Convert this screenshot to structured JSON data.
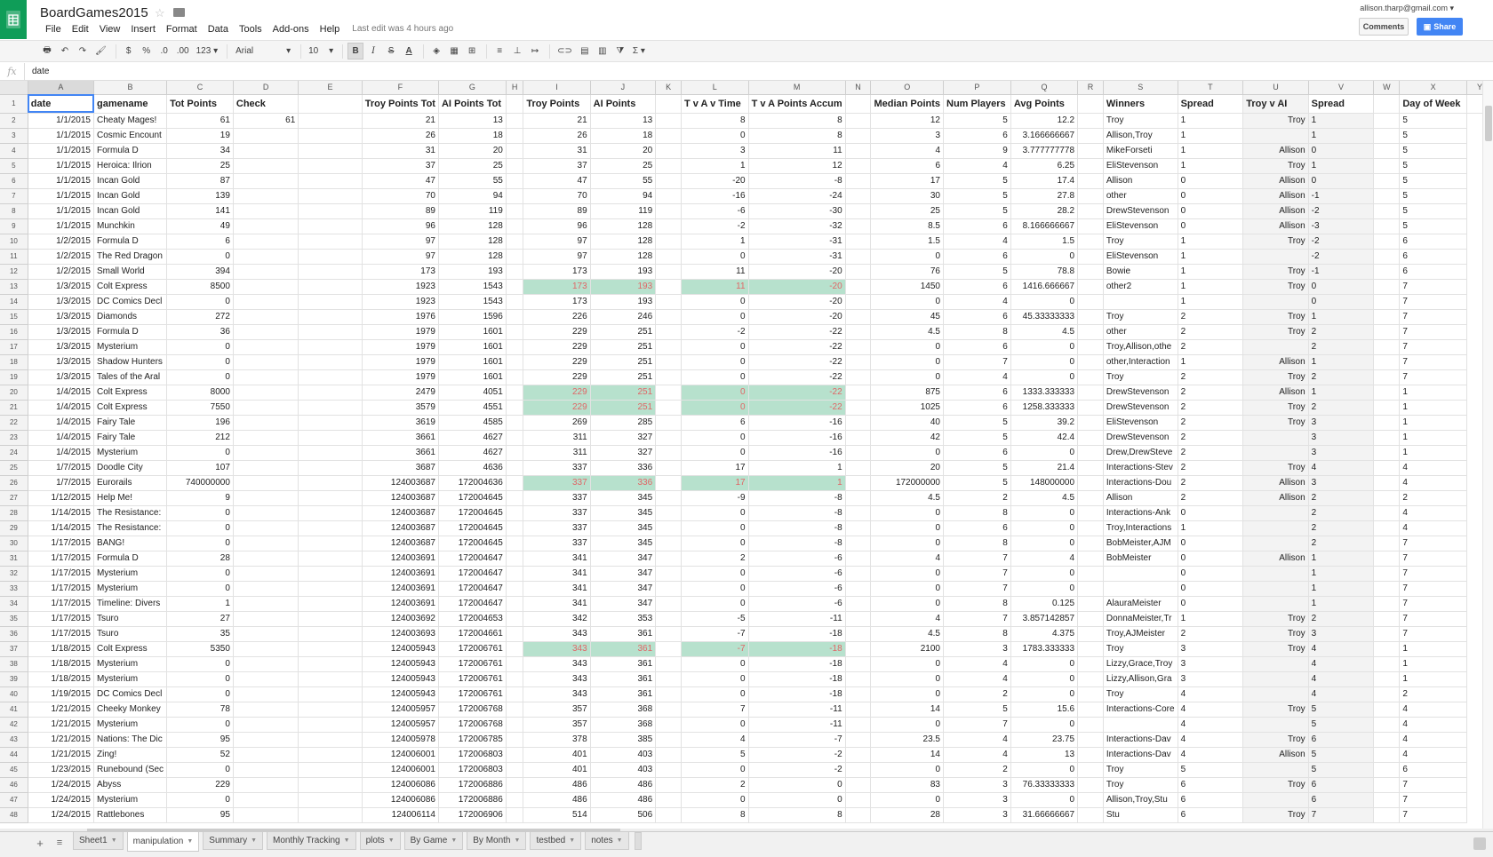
{
  "app": {
    "title": "BoardGames2015",
    "user_email": "allison.tharp@gmail.com",
    "comments_label": "Comments",
    "share_label": "Share",
    "last_edit": "Last edit was 4 hours ago",
    "menu": [
      "File",
      "Edit",
      "View",
      "Insert",
      "Format",
      "Data",
      "Tools",
      "Add-ons",
      "Help"
    ]
  },
  "toolbar": {
    "currency": "$",
    "percent": "%",
    "dec_less": ".0",
    "dec_more": ".00",
    "more_formats": "123",
    "font": "Arial",
    "size": "10",
    "bold": "B",
    "italic": "I",
    "strike": "S",
    "textcolor": "A",
    "sum": "Σ"
  },
  "formula": {
    "fx": "fx",
    "value": "date"
  },
  "columns": [
    "A",
    "B",
    "C",
    "D",
    "E",
    "F",
    "G",
    "H",
    "I",
    "J",
    "K",
    "L",
    "M",
    "N",
    "O",
    "P",
    "Q",
    "R",
    "S",
    "T",
    "U",
    "V",
    "W",
    "X",
    "Y"
  ],
  "header_row": [
    "date",
    "gamename",
    "Tot Points",
    "Check",
    "",
    "Troy Points Tot",
    "AI Points Tot",
    "",
    "Troy Points",
    "AI Points",
    "",
    "T v A v Time",
    "T v A Points Accum",
    "",
    "Median Points",
    "Num Players",
    "Avg Points",
    "",
    "Winners",
    "Spread",
    "Troy v AI",
    "Spread",
    "",
    "Day of Week",
    ""
  ],
  "rows": [
    [
      "2",
      "1/1/2015",
      "Cheaty Mages!",
      "61",
      "61",
      "",
      "21",
      "13",
      "",
      "21",
      "13",
      "",
      "8",
      "8",
      "",
      "12",
      "5",
      "12.2",
      "",
      "Troy",
      "1",
      "Troy",
      "1",
      "",
      "5"
    ],
    [
      "3",
      "1/1/2015",
      "Cosmic Encount",
      "19",
      "",
      "",
      "26",
      "18",
      "",
      "26",
      "18",
      "",
      "0",
      "8",
      "",
      "3",
      "6",
      "3.166666667",
      "",
      "Allison,Troy",
      "1",
      "",
      "1",
      "",
      "5"
    ],
    [
      "4",
      "1/1/2015",
      "Formula D",
      "34",
      "",
      "",
      "31",
      "20",
      "",
      "31",
      "20",
      "",
      "3",
      "11",
      "",
      "4",
      "9",
      "3.777777778",
      "",
      "MikeForseti",
      "1",
      "Allison",
      "0",
      "",
      "5"
    ],
    [
      "5",
      "1/1/2015",
      "Heroica: Ilrion",
      "25",
      "",
      "",
      "37",
      "25",
      "",
      "37",
      "25",
      "",
      "1",
      "12",
      "",
      "6",
      "4",
      "6.25",
      "",
      "EliStevenson",
      "1",
      "Troy",
      "1",
      "",
      "5"
    ],
    [
      "6",
      "1/1/2015",
      "Incan Gold",
      "87",
      "",
      "",
      "47",
      "55",
      "",
      "47",
      "55",
      "",
      "-20",
      "-8",
      "",
      "17",
      "5",
      "17.4",
      "",
      "Allison",
      "0",
      "Allison",
      "0",
      "",
      "5"
    ],
    [
      "7",
      "1/1/2015",
      "Incan Gold",
      "139",
      "",
      "",
      "70",
      "94",
      "",
      "70",
      "94",
      "",
      "-16",
      "-24",
      "",
      "30",
      "5",
      "27.8",
      "",
      "other",
      "0",
      "Allison",
      "-1",
      "",
      "5"
    ],
    [
      "8",
      "1/1/2015",
      "Incan Gold",
      "141",
      "",
      "",
      "89",
      "119",
      "",
      "89",
      "119",
      "",
      "-6",
      "-30",
      "",
      "25",
      "5",
      "28.2",
      "",
      "DrewStevenson",
      "0",
      "Allison",
      "-2",
      "",
      "5"
    ],
    [
      "9",
      "1/1/2015",
      "Munchkin",
      "49",
      "",
      "",
      "96",
      "128",
      "",
      "96",
      "128",
      "",
      "-2",
      "-32",
      "",
      "8.5",
      "6",
      "8.166666667",
      "",
      "EliStevenson",
      "0",
      "Allison",
      "-3",
      "",
      "5"
    ],
    [
      "10",
      "1/2/2015",
      "Formula D",
      "6",
      "",
      "",
      "97",
      "128",
      "",
      "97",
      "128",
      "",
      "1",
      "-31",
      "",
      "1.5",
      "4",
      "1.5",
      "",
      "Troy",
      "1",
      "Troy",
      "-2",
      "",
      "6"
    ],
    [
      "11",
      "1/2/2015",
      "The Red Dragon",
      "0",
      "",
      "",
      "97",
      "128",
      "",
      "97",
      "128",
      "",
      "0",
      "-31",
      "",
      "0",
      "6",
      "0",
      "",
      "EliStevenson",
      "1",
      "",
      "-2",
      "",
      "6"
    ],
    [
      "12",
      "1/2/2015",
      "Small World",
      "394",
      "",
      "",
      "173",
      "193",
      "",
      "173",
      "193",
      "",
      "11",
      "-20",
      "",
      "76",
      "5",
      "78.8",
      "",
      "Bowie",
      "1",
      "Troy",
      "-1",
      "",
      "6"
    ],
    [
      "13",
      "1/3/2015",
      "Colt Express",
      "8500",
      "",
      "",
      "1923",
      "1543",
      "",
      "173",
      "193",
      "",
      "11",
      "-20",
      "",
      "1450",
      "6",
      "1416.666667",
      "",
      "other2",
      "1",
      "Troy",
      "0",
      "",
      "7"
    ],
    [
      "14",
      "1/3/2015",
      "DC Comics Decl",
      "0",
      "",
      "",
      "1923",
      "1543",
      "",
      "173",
      "193",
      "",
      "0",
      "-20",
      "",
      "0",
      "4",
      "0",
      "",
      "",
      "1",
      "",
      "0",
      "",
      "7"
    ],
    [
      "15",
      "1/3/2015",
      "Diamonds",
      "272",
      "",
      "",
      "1976",
      "1596",
      "",
      "226",
      "246",
      "",
      "0",
      "-20",
      "",
      "45",
      "6",
      "45.33333333",
      "",
      "Troy",
      "2",
      "Troy",
      "1",
      "",
      "7"
    ],
    [
      "16",
      "1/3/2015",
      "Formula D",
      "36",
      "",
      "",
      "1979",
      "1601",
      "",
      "229",
      "251",
      "",
      "-2",
      "-22",
      "",
      "4.5",
      "8",
      "4.5",
      "",
      "other",
      "2",
      "Troy",
      "2",
      "",
      "7"
    ],
    [
      "17",
      "1/3/2015",
      "Mysterium",
      "0",
      "",
      "",
      "1979",
      "1601",
      "",
      "229",
      "251",
      "",
      "0",
      "-22",
      "",
      "0",
      "6",
      "0",
      "",
      "Troy,Allison,othe",
      "2",
      "",
      "2",
      "",
      "7"
    ],
    [
      "18",
      "1/3/2015",
      "Shadow Hunters",
      "0",
      "",
      "",
      "1979",
      "1601",
      "",
      "229",
      "251",
      "",
      "0",
      "-22",
      "",
      "0",
      "7",
      "0",
      "",
      "other,Interaction",
      "1",
      "Allison",
      "1",
      "",
      "7"
    ],
    [
      "19",
      "1/3/2015",
      "Tales of the Aral",
      "0",
      "",
      "",
      "1979",
      "1601",
      "",
      "229",
      "251",
      "",
      "0",
      "-22",
      "",
      "0",
      "4",
      "0",
      "",
      "Troy",
      "2",
      "Troy",
      "2",
      "",
      "7"
    ],
    [
      "20",
      "1/4/2015",
      "Colt Express",
      "8000",
      "",
      "",
      "2479",
      "4051",
      "",
      "229",
      "251",
      "",
      "0",
      "-22",
      "",
      "875",
      "6",
      "1333.333333",
      "",
      "DrewStevenson",
      "2",
      "Allison",
      "1",
      "",
      "1"
    ],
    [
      "21",
      "1/4/2015",
      "Colt Express",
      "7550",
      "",
      "",
      "3579",
      "4551",
      "",
      "229",
      "251",
      "",
      "0",
      "-22",
      "",
      "1025",
      "6",
      "1258.333333",
      "",
      "DrewStevenson",
      "2",
      "Troy",
      "2",
      "",
      "1"
    ],
    [
      "22",
      "1/4/2015",
      "Fairy Tale",
      "196",
      "",
      "",
      "3619",
      "4585",
      "",
      "269",
      "285",
      "",
      "6",
      "-16",
      "",
      "40",
      "5",
      "39.2",
      "",
      "EliStevenson",
      "2",
      "Troy",
      "3",
      "",
      "1"
    ],
    [
      "23",
      "1/4/2015",
      "Fairy Tale",
      "212",
      "",
      "",
      "3661",
      "4627",
      "",
      "311",
      "327",
      "",
      "0",
      "-16",
      "",
      "42",
      "5",
      "42.4",
      "",
      "DrewStevenson",
      "2",
      "",
      "3",
      "",
      "1"
    ],
    [
      "24",
      "1/4/2015",
      "Mysterium",
      "0",
      "",
      "",
      "3661",
      "4627",
      "",
      "311",
      "327",
      "",
      "0",
      "-16",
      "",
      "0",
      "6",
      "0",
      "",
      "Drew,DrewSteve",
      "2",
      "",
      "3",
      "",
      "1"
    ],
    [
      "25",
      "1/7/2015",
      "Doodle City",
      "107",
      "",
      "",
      "3687",
      "4636",
      "",
      "337",
      "336",
      "",
      "17",
      "1",
      "",
      "20",
      "5",
      "21.4",
      "",
      "Interactions-Stev",
      "2",
      "Troy",
      "4",
      "",
      "4"
    ],
    [
      "26",
      "1/7/2015",
      "Eurorails",
      "740000000",
      "",
      "",
      "124003687",
      "172004636",
      "",
      "337",
      "336",
      "",
      "17",
      "1",
      "",
      "172000000",
      "5",
      "148000000",
      "",
      "Interactions-Dou",
      "2",
      "Allison",
      "3",
      "",
      "4"
    ],
    [
      "27",
      "1/12/2015",
      "Help Me!",
      "9",
      "",
      "",
      "124003687",
      "172004645",
      "",
      "337",
      "345",
      "",
      "-9",
      "-8",
      "",
      "4.5",
      "2",
      "4.5",
      "",
      "Allison",
      "2",
      "Allison",
      "2",
      "",
      "2"
    ],
    [
      "28",
      "1/14/2015",
      "The Resistance:",
      "0",
      "",
      "",
      "124003687",
      "172004645",
      "",
      "337",
      "345",
      "",
      "0",
      "-8",
      "",
      "0",
      "8",
      "0",
      "",
      "Interactions-Ank",
      "0",
      "",
      "2",
      "",
      "4"
    ],
    [
      "29",
      "1/14/2015",
      "The Resistance:",
      "0",
      "",
      "",
      "124003687",
      "172004645",
      "",
      "337",
      "345",
      "",
      "0",
      "-8",
      "",
      "0",
      "6",
      "0",
      "",
      "Troy,Interactions",
      "1",
      "",
      "2",
      "",
      "4"
    ],
    [
      "30",
      "1/17/2015",
      "BANG!",
      "0",
      "",
      "",
      "124003687",
      "172004645",
      "",
      "337",
      "345",
      "",
      "0",
      "-8",
      "",
      "0",
      "8",
      "0",
      "",
      "BobMeister,AJM",
      "0",
      "",
      "2",
      "",
      "7"
    ],
    [
      "31",
      "1/17/2015",
      "Formula D",
      "28",
      "",
      "",
      "124003691",
      "172004647",
      "",
      "341",
      "347",
      "",
      "2",
      "-6",
      "",
      "4",
      "7",
      "4",
      "",
      "BobMeister",
      "0",
      "Allison",
      "1",
      "",
      "7"
    ],
    [
      "32",
      "1/17/2015",
      "Mysterium",
      "0",
      "",
      "",
      "124003691",
      "172004647",
      "",
      "341",
      "347",
      "",
      "0",
      "-6",
      "",
      "0",
      "7",
      "0",
      "",
      "",
      "0",
      "",
      "1",
      "",
      "7"
    ],
    [
      "33",
      "1/17/2015",
      "Mysterium",
      "0",
      "",
      "",
      "124003691",
      "172004647",
      "",
      "341",
      "347",
      "",
      "0",
      "-6",
      "",
      "0",
      "7",
      "0",
      "",
      "",
      "0",
      "",
      "1",
      "",
      "7"
    ],
    [
      "34",
      "1/17/2015",
      "Timeline: Divers",
      "1",
      "",
      "",
      "124003691",
      "172004647",
      "",
      "341",
      "347",
      "",
      "0",
      "-6",
      "",
      "0",
      "8",
      "0.125",
      "",
      "AlauraMeister",
      "0",
      "",
      "1",
      "",
      "7"
    ],
    [
      "35",
      "1/17/2015",
      "Tsuro",
      "27",
      "",
      "",
      "124003692",
      "172004653",
      "",
      "342",
      "353",
      "",
      "-5",
      "-11",
      "",
      "4",
      "7",
      "3.857142857",
      "",
      "DonnaMeister,Tr",
      "1",
      "Troy",
      "2",
      "",
      "7"
    ],
    [
      "36",
      "1/17/2015",
      "Tsuro",
      "35",
      "",
      "",
      "124003693",
      "172004661",
      "",
      "343",
      "361",
      "",
      "-7",
      "-18",
      "",
      "4.5",
      "8",
      "4.375",
      "",
      "Troy,AJMeister",
      "2",
      "Troy",
      "3",
      "",
      "7"
    ],
    [
      "37",
      "1/18/2015",
      "Colt Express",
      "5350",
      "",
      "",
      "124005943",
      "172006761",
      "",
      "343",
      "361",
      "",
      "-7",
      "-18",
      "",
      "2100",
      "3",
      "1783.333333",
      "",
      "Troy",
      "3",
      "Troy",
      "4",
      "",
      "1"
    ],
    [
      "38",
      "1/18/2015",
      "Mysterium",
      "0",
      "",
      "",
      "124005943",
      "172006761",
      "",
      "343",
      "361",
      "",
      "0",
      "-18",
      "",
      "0",
      "4",
      "0",
      "",
      "Lizzy,Grace,Troy",
      "3",
      "",
      "4",
      "",
      "1"
    ],
    [
      "39",
      "1/18/2015",
      "Mysterium",
      "0",
      "",
      "",
      "124005943",
      "172006761",
      "",
      "343",
      "361",
      "",
      "0",
      "-18",
      "",
      "0",
      "4",
      "0",
      "",
      "Lizzy,Allison,Gra",
      "3",
      "",
      "4",
      "",
      "1"
    ],
    [
      "40",
      "1/19/2015",
      "DC Comics Decl",
      "0",
      "",
      "",
      "124005943",
      "172006761",
      "",
      "343",
      "361",
      "",
      "0",
      "-18",
      "",
      "0",
      "2",
      "0",
      "",
      "Troy",
      "4",
      "",
      "4",
      "",
      "2"
    ],
    [
      "41",
      "1/21/2015",
      "Cheeky Monkey",
      "78",
      "",
      "",
      "124005957",
      "172006768",
      "",
      "357",
      "368",
      "",
      "7",
      "-11",
      "",
      "14",
      "5",
      "15.6",
      "",
      "Interactions-Core",
      "4",
      "Troy",
      "5",
      "",
      "4"
    ],
    [
      "42",
      "1/21/2015",
      "Mysterium",
      "0",
      "",
      "",
      "124005957",
      "172006768",
      "",
      "357",
      "368",
      "",
      "0",
      "-11",
      "",
      "0",
      "7",
      "0",
      "",
      "",
      "4",
      "",
      "5",
      "",
      "4"
    ],
    [
      "43",
      "1/21/2015",
      "Nations: The Dic",
      "95",
      "",
      "",
      "124005978",
      "172006785",
      "",
      "378",
      "385",
      "",
      "4",
      "-7",
      "",
      "23.5",
      "4",
      "23.75",
      "",
      "Interactions-Dav",
      "4",
      "Troy",
      "6",
      "",
      "4"
    ],
    [
      "44",
      "1/21/2015",
      "Zing!",
      "52",
      "",
      "",
      "124006001",
      "172006803",
      "",
      "401",
      "403",
      "",
      "5",
      "-2",
      "",
      "14",
      "4",
      "13",
      "",
      "Interactions-Dav",
      "4",
      "Allison",
      "5",
      "",
      "4"
    ],
    [
      "45",
      "1/23/2015",
      "Runebound (Sec",
      "0",
      "",
      "",
      "124006001",
      "172006803",
      "",
      "401",
      "403",
      "",
      "0",
      "-2",
      "",
      "0",
      "2",
      "0",
      "",
      "Troy",
      "5",
      "",
      "5",
      "",
      "6"
    ],
    [
      "46",
      "1/24/2015",
      "Abyss",
      "229",
      "",
      "",
      "124006086",
      "172006886",
      "",
      "486",
      "486",
      "",
      "2",
      "0",
      "",
      "83",
      "3",
      "76.33333333",
      "",
      "Troy",
      "6",
      "Troy",
      "6",
      "",
      "7"
    ],
    [
      "47",
      "1/24/2015",
      "Mysterium",
      "0",
      "",
      "",
      "124006086",
      "172006886",
      "",
      "486",
      "486",
      "",
      "0",
      "0",
      "",
      "0",
      "3",
      "0",
      "",
      "Allison,Troy,Stu",
      "6",
      "",
      "6",
      "",
      "7"
    ],
    [
      "48",
      "1/24/2015",
      "Rattlebones",
      "95",
      "",
      "",
      "124006114",
      "172006906",
      "",
      "514",
      "506",
      "",
      "8",
      "8",
      "",
      "28",
      "3",
      "31.66666667",
      "",
      "Stu",
      "6",
      "Troy",
      "7",
      "",
      "7"
    ]
  ],
  "highlight_rows": [
    "13",
    "20",
    "21",
    "26",
    "37"
  ],
  "tabs": [
    {
      "label": "Sheet1",
      "active": false
    },
    {
      "label": "manipulation",
      "active": true
    },
    {
      "label": "Summary",
      "active": false
    },
    {
      "label": "Monthly Tracking",
      "active": false
    },
    {
      "label": "plots",
      "active": false
    },
    {
      "label": "By Game",
      "active": false
    },
    {
      "label": "By Month",
      "active": false
    },
    {
      "label": "testbed",
      "active": false
    },
    {
      "label": "notes",
      "active": false
    }
  ],
  "colors": {
    "brand": "#0f9d58",
    "share": "#4285f4",
    "highlight": "#b7e1cd",
    "red_text": "#e06666"
  }
}
